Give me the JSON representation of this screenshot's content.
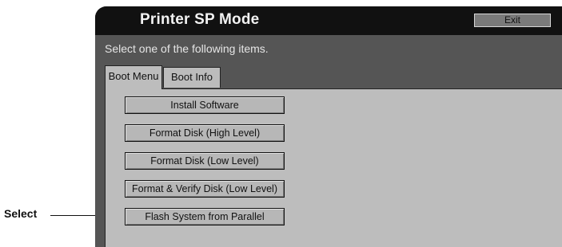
{
  "window": {
    "title": "Printer SP Mode",
    "exit_label": "Exit",
    "instruction": "Select one of the following items."
  },
  "tabs": [
    {
      "label": "Boot Menu",
      "active": true
    },
    {
      "label": "Boot Info",
      "active": false
    }
  ],
  "boot_menu": {
    "items": [
      {
        "label": "Install Software"
      },
      {
        "label": "Format Disk (High Level)"
      },
      {
        "label": "Format Disk (Low Level)"
      },
      {
        "label": "Format & Verify Disk (Low Level)"
      },
      {
        "label": "Flash System from Parallel"
      }
    ]
  },
  "annotation": {
    "label": "Select"
  },
  "colors": {
    "titlebar": "#111111",
    "panel": "#555555",
    "content": "#bdbdbd"
  }
}
